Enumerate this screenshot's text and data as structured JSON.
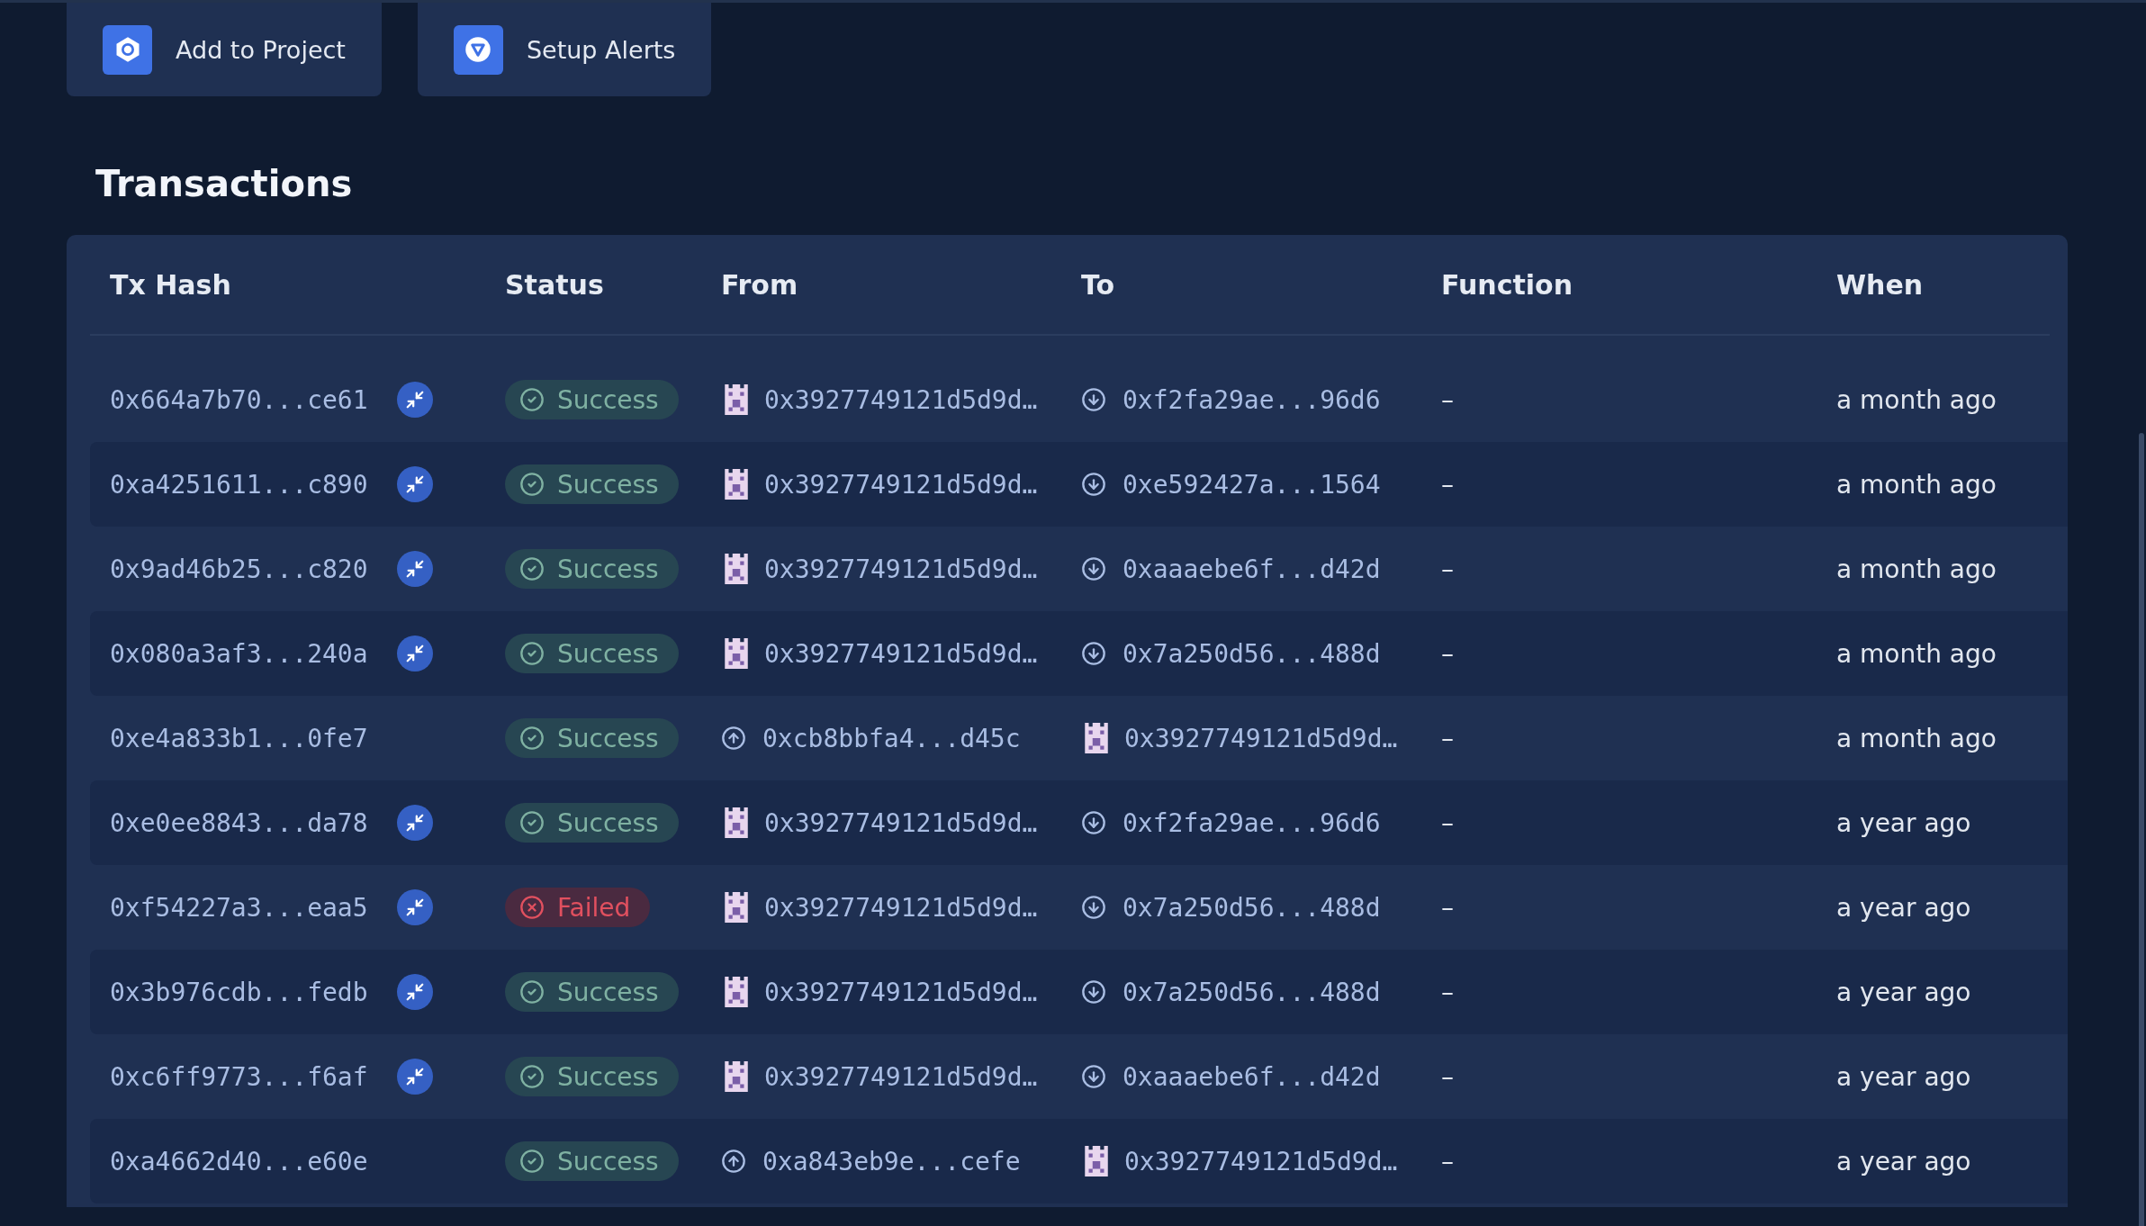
{
  "actions": [
    {
      "kind": "project",
      "label": "Add to Project"
    },
    {
      "kind": "alerts",
      "label": "Setup Alerts"
    }
  ],
  "section_title": "Transactions",
  "table": {
    "columns": [
      "Tx Hash",
      "Status",
      "From",
      "To",
      "Function",
      "When"
    ],
    "rows": [
      {
        "hash": "0x664a7b70...ce61",
        "internal": true,
        "status": {
          "kind": "success",
          "label": "Success"
        },
        "from": {
          "kind": "avatar",
          "text": "0x3927749121d5d9d…"
        },
        "to": {
          "kind": "incoming",
          "text": "0xf2fa29ae...96d6"
        },
        "function": "–",
        "when": "a month ago"
      },
      {
        "hash": "0xa4251611...c890",
        "internal": true,
        "status": {
          "kind": "success",
          "label": "Success"
        },
        "from": {
          "kind": "avatar",
          "text": "0x3927749121d5d9d…"
        },
        "to": {
          "kind": "incoming",
          "text": "0xe592427a...1564"
        },
        "function": "–",
        "when": "a month ago"
      },
      {
        "hash": "0x9ad46b25...c820",
        "internal": true,
        "status": {
          "kind": "success",
          "label": "Success"
        },
        "from": {
          "kind": "avatar",
          "text": "0x3927749121d5d9d…"
        },
        "to": {
          "kind": "incoming",
          "text": "0xaaaebe6f...d42d"
        },
        "function": "–",
        "when": "a month ago"
      },
      {
        "hash": "0x080a3af3...240a",
        "internal": true,
        "status": {
          "kind": "success",
          "label": "Success"
        },
        "from": {
          "kind": "avatar",
          "text": "0x3927749121d5d9d…"
        },
        "to": {
          "kind": "incoming",
          "text": "0x7a250d56...488d"
        },
        "function": "–",
        "when": "a month ago"
      },
      {
        "hash": "0xe4a833b1...0fe7",
        "internal": false,
        "status": {
          "kind": "success",
          "label": "Success"
        },
        "from": {
          "kind": "outgoing",
          "text": "0xcb8bbfa4...d45c"
        },
        "to": {
          "kind": "avatar",
          "text": "0x3927749121d5d9d…"
        },
        "function": "–",
        "when": "a month ago"
      },
      {
        "hash": "0xe0ee8843...da78",
        "internal": true,
        "status": {
          "kind": "success",
          "label": "Success"
        },
        "from": {
          "kind": "avatar",
          "text": "0x3927749121d5d9d…"
        },
        "to": {
          "kind": "incoming",
          "text": "0xf2fa29ae...96d6"
        },
        "function": "–",
        "when": "a year ago"
      },
      {
        "hash": "0xf54227a3...eaa5",
        "internal": true,
        "status": {
          "kind": "failed",
          "label": "Failed"
        },
        "from": {
          "kind": "avatar",
          "text": "0x3927749121d5d9d…"
        },
        "to": {
          "kind": "incoming",
          "text": "0x7a250d56...488d"
        },
        "function": "–",
        "when": "a year ago"
      },
      {
        "hash": "0x3b976cdb...fedb",
        "internal": true,
        "status": {
          "kind": "success",
          "label": "Success"
        },
        "from": {
          "kind": "avatar",
          "text": "0x3927749121d5d9d…"
        },
        "to": {
          "kind": "incoming",
          "text": "0x7a250d56...488d"
        },
        "function": "–",
        "when": "a year ago"
      },
      {
        "hash": "0xc6ff9773...f6af",
        "internal": true,
        "status": {
          "kind": "success",
          "label": "Success"
        },
        "from": {
          "kind": "avatar",
          "text": "0x3927749121d5d9d…"
        },
        "to": {
          "kind": "incoming",
          "text": "0xaaaebe6f...d42d"
        },
        "function": "–",
        "when": "a year ago"
      },
      {
        "hash": "0xa4662d40...e60e",
        "internal": false,
        "status": {
          "kind": "success",
          "label": "Success"
        },
        "from": {
          "kind": "outgoing",
          "text": "0xa843eb9e...cefe"
        },
        "to": {
          "kind": "avatar",
          "text": "0x3927749121d5d9d…"
        },
        "function": "–",
        "when": "a year ago"
      }
    ]
  }
}
